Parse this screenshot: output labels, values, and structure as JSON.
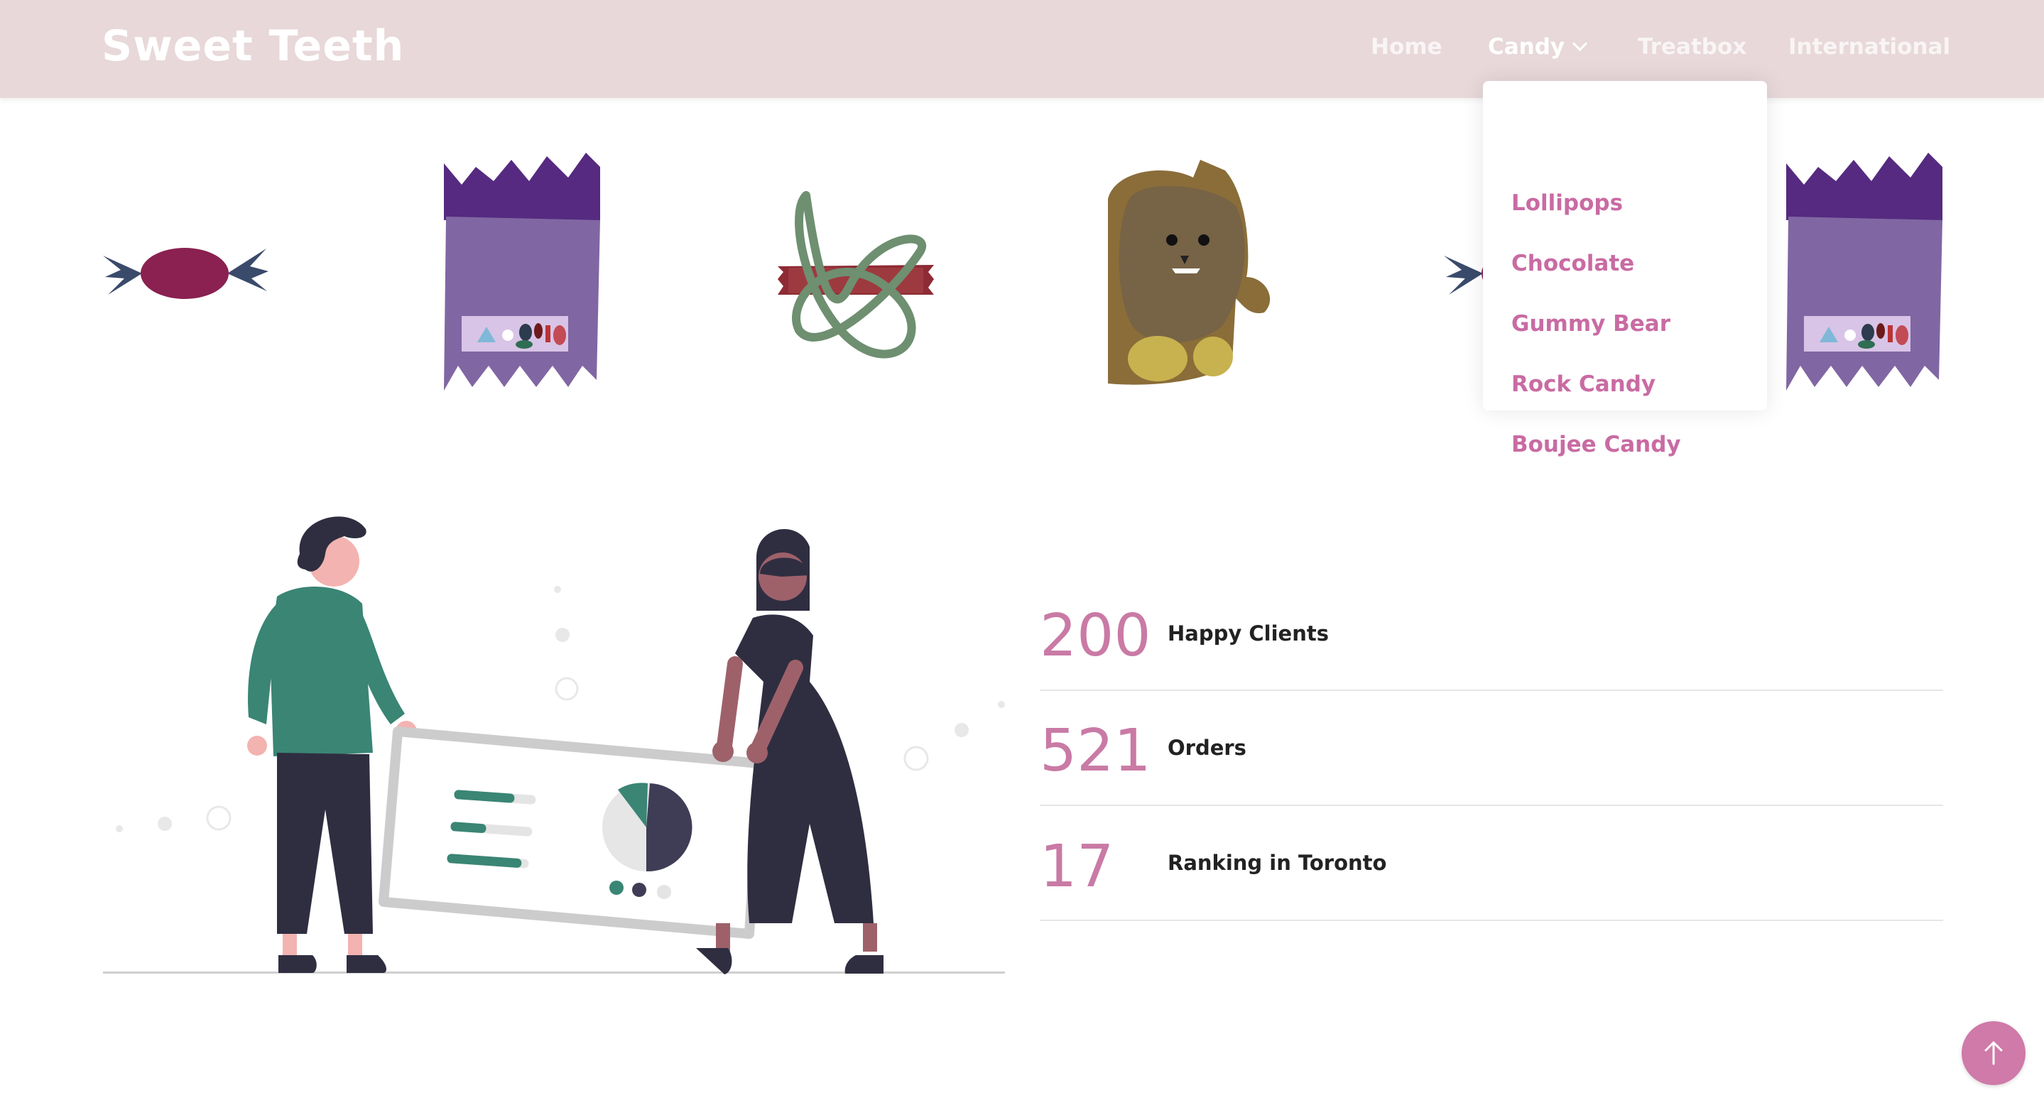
{
  "header": {
    "brand": "Sweet Teeth",
    "nav": [
      {
        "label": "Home"
      },
      {
        "label": "Candy"
      },
      {
        "label": "Treatbox"
      },
      {
        "label": "International"
      }
    ]
  },
  "dropdown": {
    "items": [
      "Lollipops",
      "Chocolate",
      "Gummy Bear",
      "Rock Candy",
      "Boujee Candy"
    ]
  },
  "stats": [
    {
      "value": "200",
      "label": "Happy Clients"
    },
    {
      "value": "521",
      "label": "Orders"
    },
    {
      "value": "17",
      "label": "Ranking in Toronto"
    }
  ],
  "colors": {
    "header_bg": "#e8d8d9",
    "accent": "#c96ba3",
    "stat_number": "#c97aa5"
  },
  "icons": {
    "back_to_top": "arrow-up-icon",
    "nav_chevron": "chevron-down-icon"
  }
}
